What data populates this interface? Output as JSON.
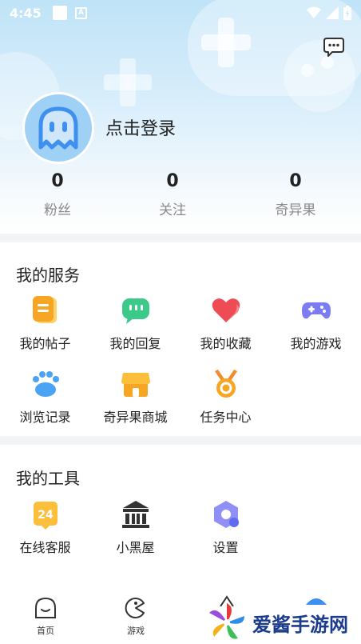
{
  "status_bar": {
    "time": "4:45",
    "notif_letter": "A"
  },
  "profile": {
    "login_text": "点击登录"
  },
  "stats": [
    {
      "value": "0",
      "label": "粉丝"
    },
    {
      "value": "0",
      "label": "关注"
    },
    {
      "value": "0",
      "label": "奇异果"
    }
  ],
  "services": {
    "title": "我的服务",
    "items": [
      {
        "label": "我的帖子",
        "icon": "posts-icon"
      },
      {
        "label": "我的回复",
        "icon": "reply-icon"
      },
      {
        "label": "我的收藏",
        "icon": "heart-icon"
      },
      {
        "label": "我的游戏",
        "icon": "gamepad-icon"
      },
      {
        "label": "浏览记录",
        "icon": "paw-icon"
      },
      {
        "label": "奇异果商城",
        "icon": "shop-icon"
      },
      {
        "label": "任务中心",
        "icon": "medal-icon"
      }
    ]
  },
  "tools": {
    "title": "我的工具",
    "items": [
      {
        "label": "在线客服",
        "icon": "service-24-icon",
        "badge": "24"
      },
      {
        "label": "小黑屋",
        "icon": "jail-icon"
      },
      {
        "label": "设置",
        "icon": "settings-icon"
      }
    ]
  },
  "tabs": [
    {
      "label": "首页",
      "icon": "home-icon"
    },
    {
      "label": "游戏",
      "icon": "game-tab-icon"
    }
  ],
  "watermark": {
    "text": "爱酱手游网"
  },
  "colors": {
    "header_top": "#bfe3f7",
    "avatar_bg": "#9fd0f5",
    "ghost_blue": "#3d8ff0",
    "section_bg": "#f2f4f6",
    "watermark_blue": "#1b3c8c"
  }
}
